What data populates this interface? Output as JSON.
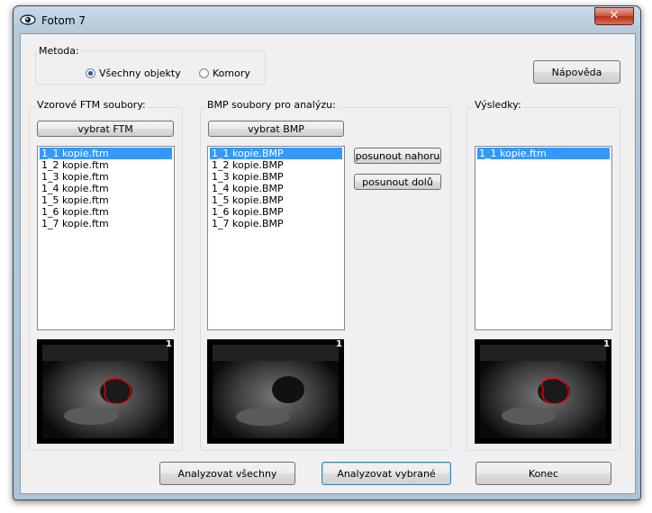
{
  "window": {
    "title": "Fotom 7",
    "close_glyph": "✕"
  },
  "metoda": {
    "label": "Metoda:",
    "options": [
      {
        "label": "Všechny objekty",
        "checked": true
      },
      {
        "label": "Komory",
        "checked": false
      }
    ]
  },
  "help_button": "Nápověda",
  "ftm": {
    "label": "Vzorové FTM soubory:",
    "button": "vybrat FTM",
    "items": [
      "1_1 kopie.ftm",
      "1_2 kopie.ftm",
      "1_3 kopie.ftm",
      "1_4 kopie.ftm",
      "1_5 kopie.ftm",
      "1_6 kopie.ftm",
      "1_7 kopie.ftm"
    ]
  },
  "bmp": {
    "label": "BMP soubory pro analýzu:",
    "button": "vybrat BMP",
    "items": [
      "1_1 kopie.BMP",
      "1_2 kopie.BMP",
      "1_3 kopie.BMP",
      "1_4 kopie.BMP",
      "1_5 kopie.BMP",
      "1_6 kopie.BMP",
      "1_7 kopie.BMP"
    ],
    "move_up": "posunout nahoru",
    "move_down": "posunout dolů"
  },
  "results": {
    "label": "Výsledky:",
    "items": [
      "1_1 kopie.ftm"
    ]
  },
  "thumb_badge": "1",
  "buttons": {
    "analyze_all": "Analyzovat všechny",
    "analyze_selected": "Analyzovat vybrané",
    "end": "Konec"
  },
  "colors": {
    "selection": "#3399ff",
    "contour": "#ff0000"
  }
}
